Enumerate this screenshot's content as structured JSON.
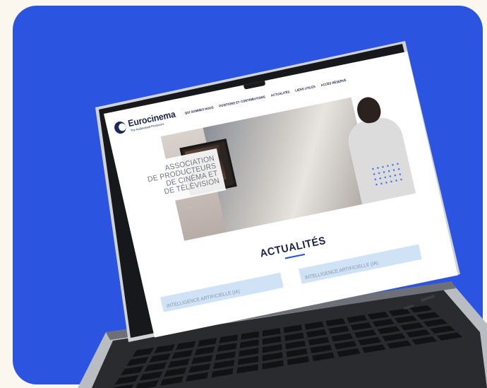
{
  "site": {
    "logo_name": "Eurocinema",
    "logo_tagline": "The Audiovisual Producers",
    "nav": [
      "QUI SOMMES NOUS",
      "POSITIONS ET CONTRIBUTIONS",
      "ACTUALITÉS",
      "LIENS UTILES",
      "ACCÈS RÉSERVÉ"
    ],
    "hero_title_lines": [
      "ASSOCIATION",
      "DE PRODUCTEURS",
      "DE CINÉMA ET",
      "DE TÉLÉVISION"
    ],
    "news_heading": "ACTUALITÉS",
    "news_cards": [
      {
        "label": "INTELLIGENCE ARTIFICIELLE (IA)"
      },
      {
        "label": "INTELLIGENCE ARTIFICIELLE (IA)"
      }
    ]
  },
  "colors": {
    "background": "#fbf7ee",
    "card_blue": "#2b55e0",
    "laptop_body": "#c7c9cc",
    "laptop_dark": "#1c1d20",
    "accent_blue": "#2b55e0",
    "card_bar": "#cfe2f6"
  }
}
